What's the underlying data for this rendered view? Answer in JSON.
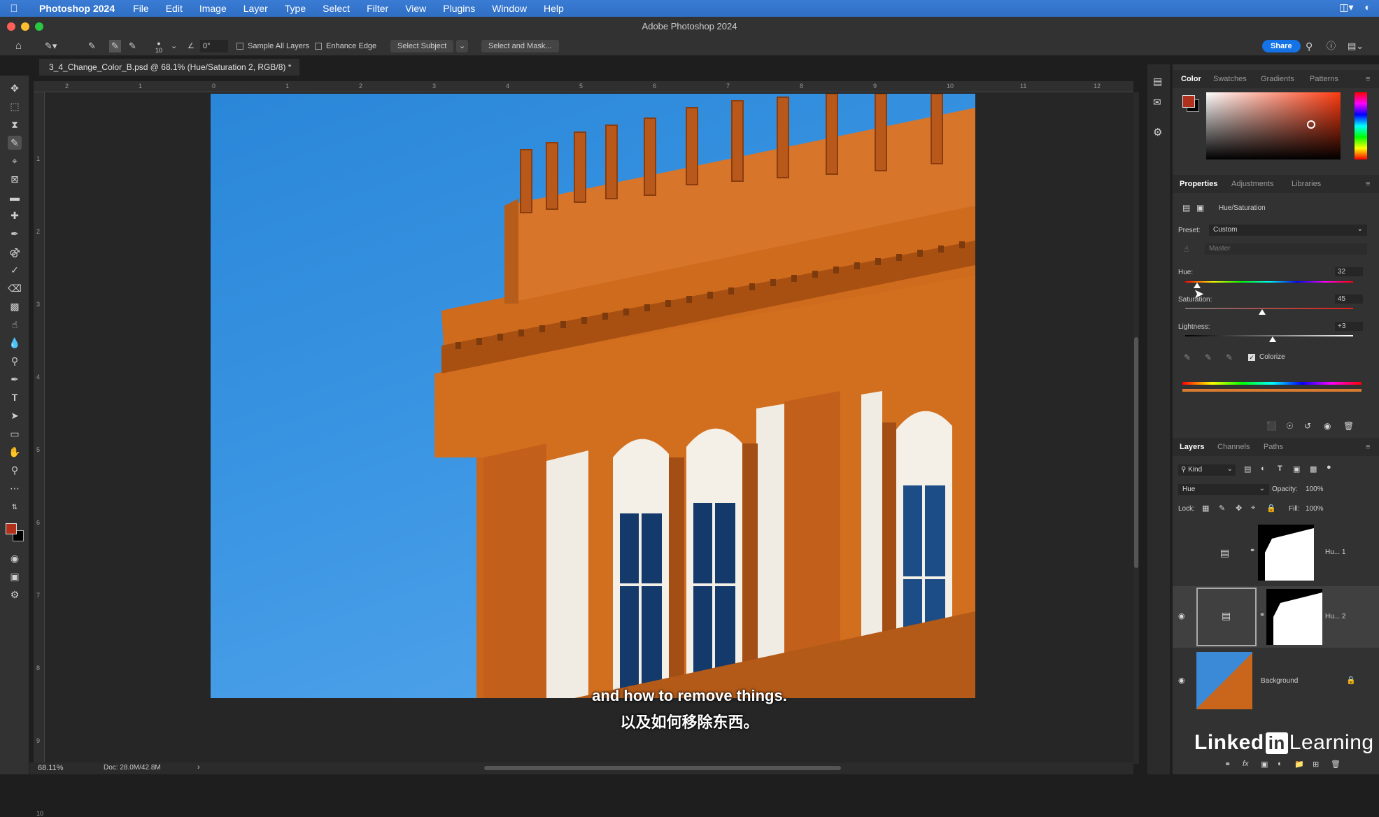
{
  "menubar": {
    "app": "Photoshop 2024",
    "items": [
      "File",
      "Edit",
      "Image",
      "Layer",
      "Type",
      "Select",
      "Filter",
      "View",
      "Plugins",
      "Window",
      "Help"
    ]
  },
  "window": {
    "title": "Adobe Photoshop 2024"
  },
  "options": {
    "brush_size": "10",
    "angle": "0°",
    "sample_all_layers": "Sample All Layers",
    "enhance_edge": "Enhance Edge",
    "select_subject": "Select Subject",
    "select_and_mask": "Select and Mask...",
    "share": "Share"
  },
  "document": {
    "tab": "3_4_Change_Color_B.psd @ 68.1% (Hue/Saturation 2, RGB/8) *"
  },
  "ruler": {
    "top": [
      "2",
      "1",
      "0",
      "1",
      "2",
      "3",
      "4",
      "5",
      "6",
      "7",
      "8",
      "9",
      "10",
      "11",
      "12"
    ],
    "left": [
      "1",
      "2",
      "3",
      "4",
      "5",
      "6",
      "7",
      "8",
      "9",
      "10"
    ]
  },
  "subtitles": {
    "en": "and how to remove things.",
    "zh": "以及如何移除东西。"
  },
  "status": {
    "zoom": "68.11%",
    "doc": "Doc: 28.0M/42.8M",
    "arrow": "›"
  },
  "color_panel": {
    "tabs": [
      "Color",
      "Swatches",
      "Gradients",
      "Patterns"
    ],
    "foreground": "#b0301c",
    "background": "#000000"
  },
  "properties": {
    "tabs": [
      "Properties",
      "Adjustments",
      "Libraries"
    ],
    "adjustment": "Hue/Saturation",
    "preset_label": "Preset:",
    "preset_value": "Custom",
    "channel": "Master",
    "hue_label": "Hue:",
    "hue_value": "32",
    "saturation_label": "Saturation:",
    "saturation_value": "45",
    "lightness_label": "Lightness:",
    "lightness_value": "+3",
    "colorize": "Colorize"
  },
  "layers": {
    "tabs": [
      "Layers",
      "Channels",
      "Paths"
    ],
    "kind": "Kind",
    "blend_mode": "Hue",
    "opacity_label": "Opacity:",
    "opacity_value": "100%",
    "lock_label": "Lock:",
    "fill_label": "Fill:",
    "fill_value": "100%",
    "items": [
      {
        "name": "Hu... 1"
      },
      {
        "name": "Hu... 2"
      },
      {
        "name": "Background"
      }
    ]
  },
  "watermark": {
    "linked": "Linked",
    "in": "in",
    "learning": "Learning"
  }
}
